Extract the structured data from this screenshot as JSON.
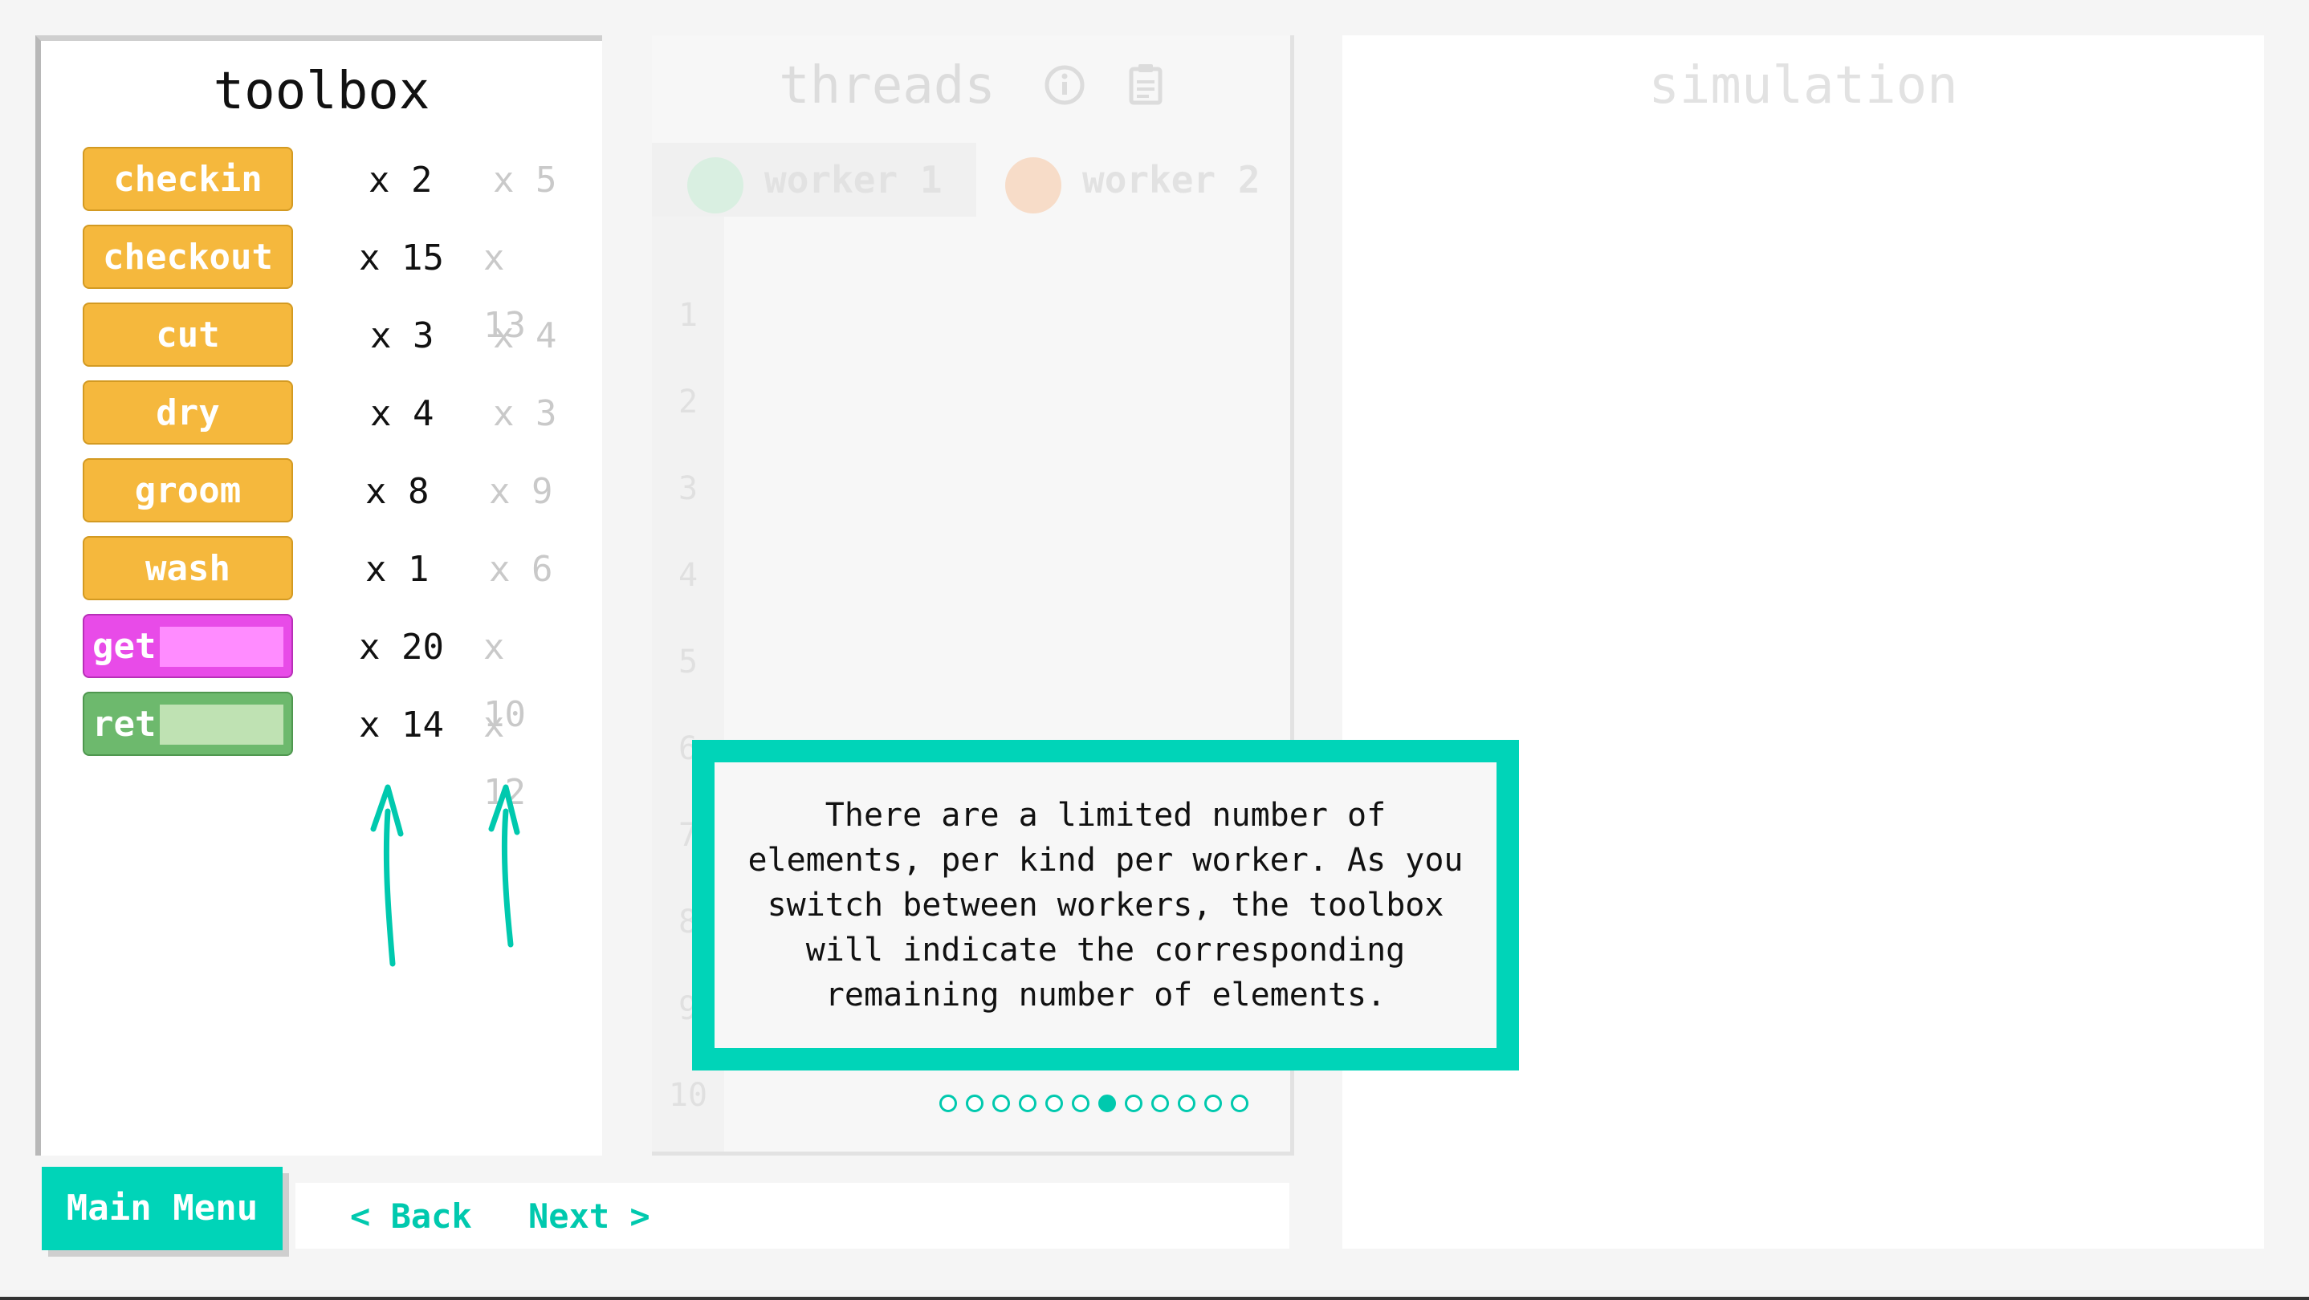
{
  "toolbox": {
    "title": "toolbox",
    "items": [
      {
        "label": "checkin",
        "count": "x 2",
        "other_count": "x 5"
      },
      {
        "label": "checkout",
        "count": "x 15",
        "other_count": "x 13"
      },
      {
        "label": "cut",
        "count": "x 3",
        "other_count": "x 4"
      },
      {
        "label": "dry",
        "count": "x 4",
        "other_count": "x 3"
      },
      {
        "label": "groom",
        "count": "x 8",
        "other_count": "x 9"
      },
      {
        "label": "wash",
        "count": "x 1",
        "other_count": "x 6"
      },
      {
        "label": "get",
        "count": "x 20",
        "other_count": "x 10"
      },
      {
        "label": "ret",
        "count": "x 14",
        "other_count": "x 12"
      }
    ]
  },
  "threads": {
    "title": "threads",
    "info_icon": "info-icon",
    "clipboard_icon": "clipboard-icon",
    "tabs": [
      {
        "label": "worker 1",
        "avatar": "worker-avatar"
      },
      {
        "label": "worker 2",
        "avatar": "worker-avatar"
      }
    ],
    "line_numbers": [
      "1",
      "2",
      "3",
      "4",
      "5",
      "6",
      "7",
      "8",
      "9",
      "10"
    ]
  },
  "simulation": {
    "title": "simulation"
  },
  "tutorial": {
    "message": "There are a limited number of elements, per kind per worker. As you switch between workers, the toolbox will indicate the corresponding remaining number of elements.",
    "steps_total": 12,
    "current_step": 7
  },
  "nav": {
    "main_menu": "Main Menu",
    "back": "< Back",
    "next": "Next >"
  },
  "colors": {
    "accent": "#00d4b8",
    "block_yellow": "#f5b83d",
    "block_pink": "#e84be8",
    "block_green": "#6db96d"
  }
}
